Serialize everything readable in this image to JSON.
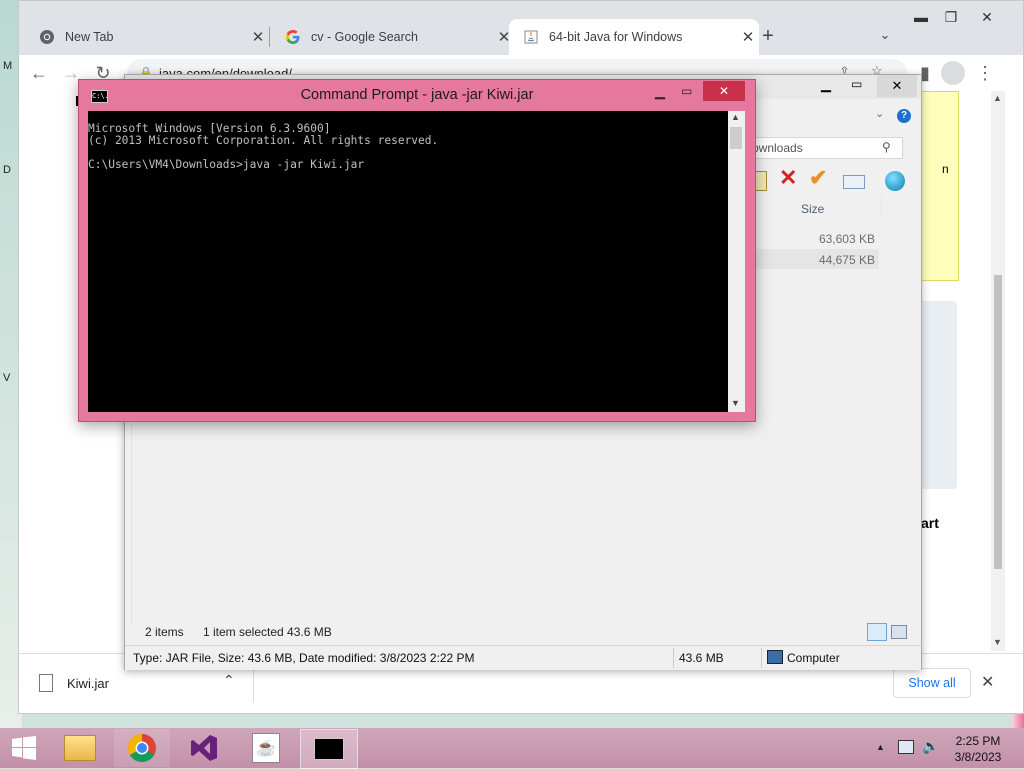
{
  "edge_letters": [
    "M",
    "D",
    "V"
  ],
  "chrome": {
    "tabs": [
      {
        "title": "New Tab",
        "icon": "chrome-icon"
      },
      {
        "title": "cv - Google Search",
        "icon": "google-icon"
      },
      {
        "title": "64-bit Java for Windows",
        "icon": "java-icon"
      }
    ],
    "new_tab_label": "+",
    "url": "java.com/en/download/",
    "page_fragments": {
      "left": "K",
      "right_top": "n",
      "right_heading": "art"
    }
  },
  "download_bar": {
    "file_name": "Kiwi.jar",
    "show_all_label": "Show all"
  },
  "explorer": {
    "search_placeholder": "ownloads",
    "column_size": "Size",
    "rows": [
      {
        "size": "63,603 KB"
      },
      {
        "size": "44,675 KB"
      }
    ],
    "status_items": "2 items",
    "status_selected": "1 item selected  43.6 MB",
    "details": "Type: JAR File, Size: 43.6 MB, Date modified: 3/8/2023 2:22 PM",
    "details_size": "43.6 MB",
    "details_location": "Computer"
  },
  "cmd": {
    "title": "Command Prompt - java  -jar Kiwi.jar",
    "icon_label": "C:\\.",
    "console_lines": [
      "Microsoft Windows [Version 6.3.9600]",
      "(c) 2013 Microsoft Corporation. All rights reserved.",
      "",
      "C:\\Users\\VM4\\Downloads>java -jar Kiwi.jar"
    ]
  },
  "taskbar": {
    "apps": [
      "file-explorer-icon",
      "chrome-icon",
      "visual-studio-icon",
      "java-icon",
      "command-prompt-icon"
    ],
    "time": "2:25 PM",
    "date": "3/8/2023",
    "colors": {
      "accent_pink": "#e6789e",
      "taskbar": "#c99bb0"
    }
  }
}
